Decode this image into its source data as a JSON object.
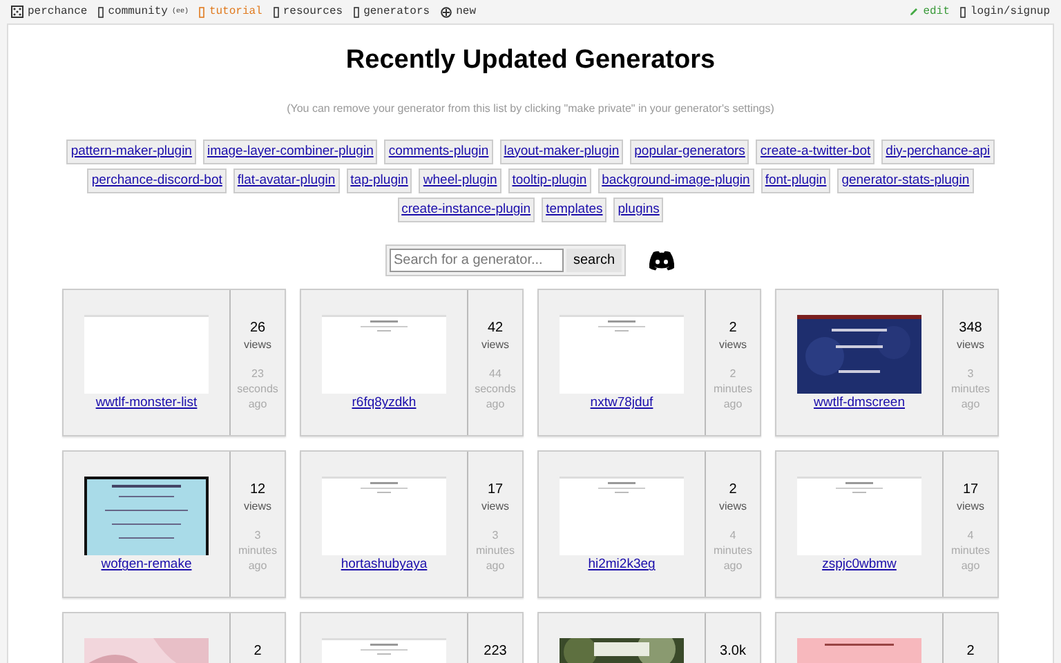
{
  "nav": {
    "left": [
      {
        "label": "perchance"
      },
      {
        "label": "community",
        "badge": "(ee)"
      },
      {
        "label": "tutorial",
        "kind": "highlight"
      },
      {
        "label": "resources"
      },
      {
        "label": "generators"
      },
      {
        "label": "new"
      }
    ],
    "right": [
      {
        "label": "edit",
        "kind": "green"
      },
      {
        "label": "login/signup"
      }
    ]
  },
  "title": "Recently Updated Generators",
  "subtitle": "(You can remove your generator from this list by clicking \"make private\" in your generator's settings)",
  "tags": [
    [
      "pattern-maker-plugin",
      "image-layer-combiner-plugin",
      "comments-plugin",
      "layout-maker-plugin",
      "popular-generators",
      "create-a-twitter-bot",
      "diy-perchance-api"
    ],
    [
      "perchance-discord-bot",
      "flat-avatar-plugin",
      "tap-plugin",
      "wheel-plugin",
      "tooltip-plugin",
      "background-image-plugin",
      "font-plugin",
      "generator-stats-plugin"
    ],
    [
      "create-instance-plugin",
      "templates",
      "plugins"
    ]
  ],
  "search": {
    "placeholder": "Search for a generator...",
    "button": "search"
  },
  "cards": [
    {
      "name": "wwtlf-monster-list",
      "views": "26",
      "views_label": "views",
      "age": [
        "23",
        "seconds",
        "ago"
      ]
    },
    {
      "name": "r6fq8yzdkh",
      "views": "42",
      "views_label": "views",
      "age": [
        "44",
        "seconds",
        "ago"
      ]
    },
    {
      "name": "nxtw78jduf",
      "views": "2",
      "views_label": "views",
      "age": [
        "2",
        "minutes",
        "ago"
      ]
    },
    {
      "name": "wwtlf-dmscreen",
      "views": "348",
      "views_label": "views",
      "age": [
        "3",
        "minutes",
        "ago"
      ]
    },
    {
      "name": "wofgen-remake",
      "views": "12",
      "views_label": "views",
      "age": [
        "3",
        "minutes",
        "ago"
      ]
    },
    {
      "name": "hortashubyaya",
      "views": "17",
      "views_label": "views",
      "age": [
        "3",
        "minutes",
        "ago"
      ]
    },
    {
      "name": "hi2mi2k3eg",
      "views": "2",
      "views_label": "views",
      "age": [
        "4",
        "minutes",
        "ago"
      ]
    },
    {
      "name": "zspjc0wbmw",
      "views": "17",
      "views_label": "views",
      "age": [
        "4",
        "minutes",
        "ago"
      ]
    },
    {
      "views": "2"
    },
    {
      "views": "223"
    },
    {
      "views": "3.0k"
    },
    {
      "views": "2"
    }
  ]
}
